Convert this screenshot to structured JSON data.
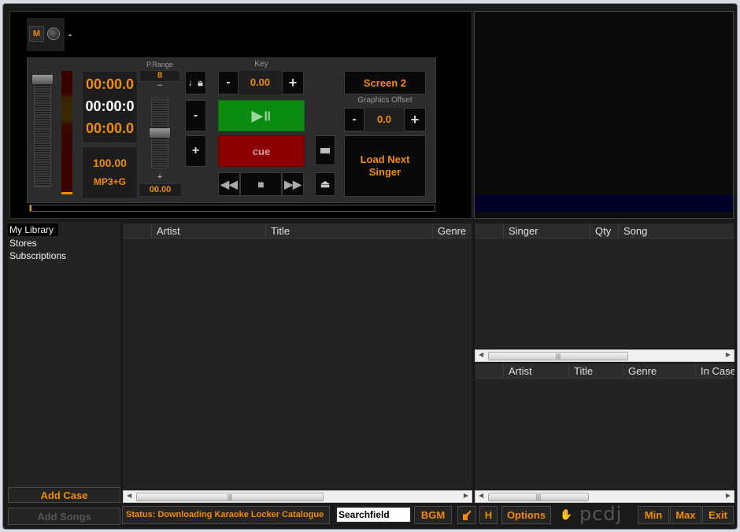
{
  "deck": {
    "m_button": "M",
    "title_text": "-",
    "p_range_label": "P.Range",
    "p_range_value": "8",
    "pitch_minus": "–",
    "pitch_plus": "+",
    "pitch_value": "00.00",
    "time_elapsed": "00:00.0",
    "time_total": "00:00:0",
    "time_remaining": "00:00.0",
    "bpm": "100.00",
    "format": "MP3+G",
    "key_label": "Key",
    "key_value": "0.00",
    "key_minus": "-",
    "key_plus": "+",
    "tempo_minus": "-",
    "tempo_plus": "+",
    "cue_label": "cue",
    "screen_button": "Screen 2",
    "graphics_offset_label": "Graphics Offset",
    "graphics_offset_value": "0.0",
    "offset_minus": "-",
    "offset_plus": "+",
    "load_next_singer": "Load Next Singer",
    "progress": 0
  },
  "sidebar": {
    "items": [
      {
        "label": "My Library",
        "selected": true
      },
      {
        "label": "Stores",
        "selected": false
      },
      {
        "label": "Subscriptions",
        "selected": false
      }
    ],
    "add_case": "Add Case",
    "add_songs": "Add Songs"
  },
  "library": {
    "columns": [
      "",
      "Artist",
      "Title",
      "Genre"
    ]
  },
  "singers": {
    "columns": [
      "",
      "Singer",
      "Qty",
      "Song"
    ]
  },
  "case": {
    "columns": [
      "",
      "Artist",
      "Title",
      "Genre",
      "In Case"
    ]
  },
  "bottom": {
    "status": "Status: Downloading Karaoke Locker Catalogue",
    "search_value": "Searchfield",
    "bgm": "BGM",
    "h_button": "H",
    "options": "Options",
    "logo": "pcdj",
    "min": "Min",
    "max": "Max",
    "exit": "Exit"
  },
  "colors": {
    "accent": "#f08c00",
    "play": "#0a8c10",
    "cue": "#8c0000"
  }
}
